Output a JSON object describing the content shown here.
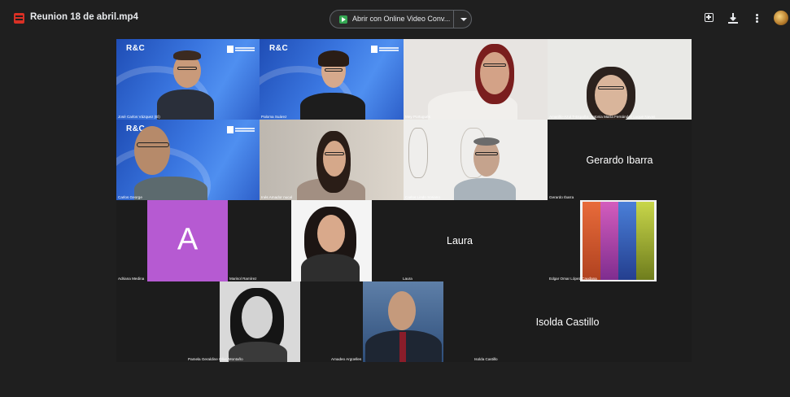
{
  "window": {
    "file_title": "Reunion 18 de abril.mp4",
    "open_with_label": "Abrir con Online Video Conv...",
    "icons": [
      "file-video-icon",
      "app-icon",
      "chevron-down-icon",
      "add-to-drive-icon",
      "download-icon",
      "more-vert-icon"
    ]
  },
  "participants": [
    {
      "name": "José Carlos Vázquez (El)"
    },
    {
      "name": "Paloma Suárez"
    },
    {
      "name": "Mey Portugués"
    },
    {
      "name": "Amarillo-Azul T-España: Antonia María Fernández Luque Navas"
    },
    {
      "name": "Carlos George"
    },
    {
      "name": "Inés Amador nucal"
    },
    {
      "name": "Carlos Lindo Soriano"
    },
    {
      "name": "Gerardo Ibarra",
      "display": "Gerardo Ibarra"
    },
    {
      "name": "Adriana Medina",
      "initial": "A"
    },
    {
      "name": "Marisol Ramírez"
    },
    {
      "name": "Laura",
      "display": "Laura"
    },
    {
      "name": "Edgar Omar López Caudana"
    },
    {
      "name": "Pamela Geraldine Olivo Montaño"
    },
    {
      "name": "Amadeo Argüelles"
    },
    {
      "name": "Isolda Castillo",
      "display": "Isolda Castillo"
    }
  ],
  "colors": {
    "background": "#1f1f1f",
    "tile_blue": "#3a76e0",
    "avatar_purple": "#b65ad2"
  }
}
